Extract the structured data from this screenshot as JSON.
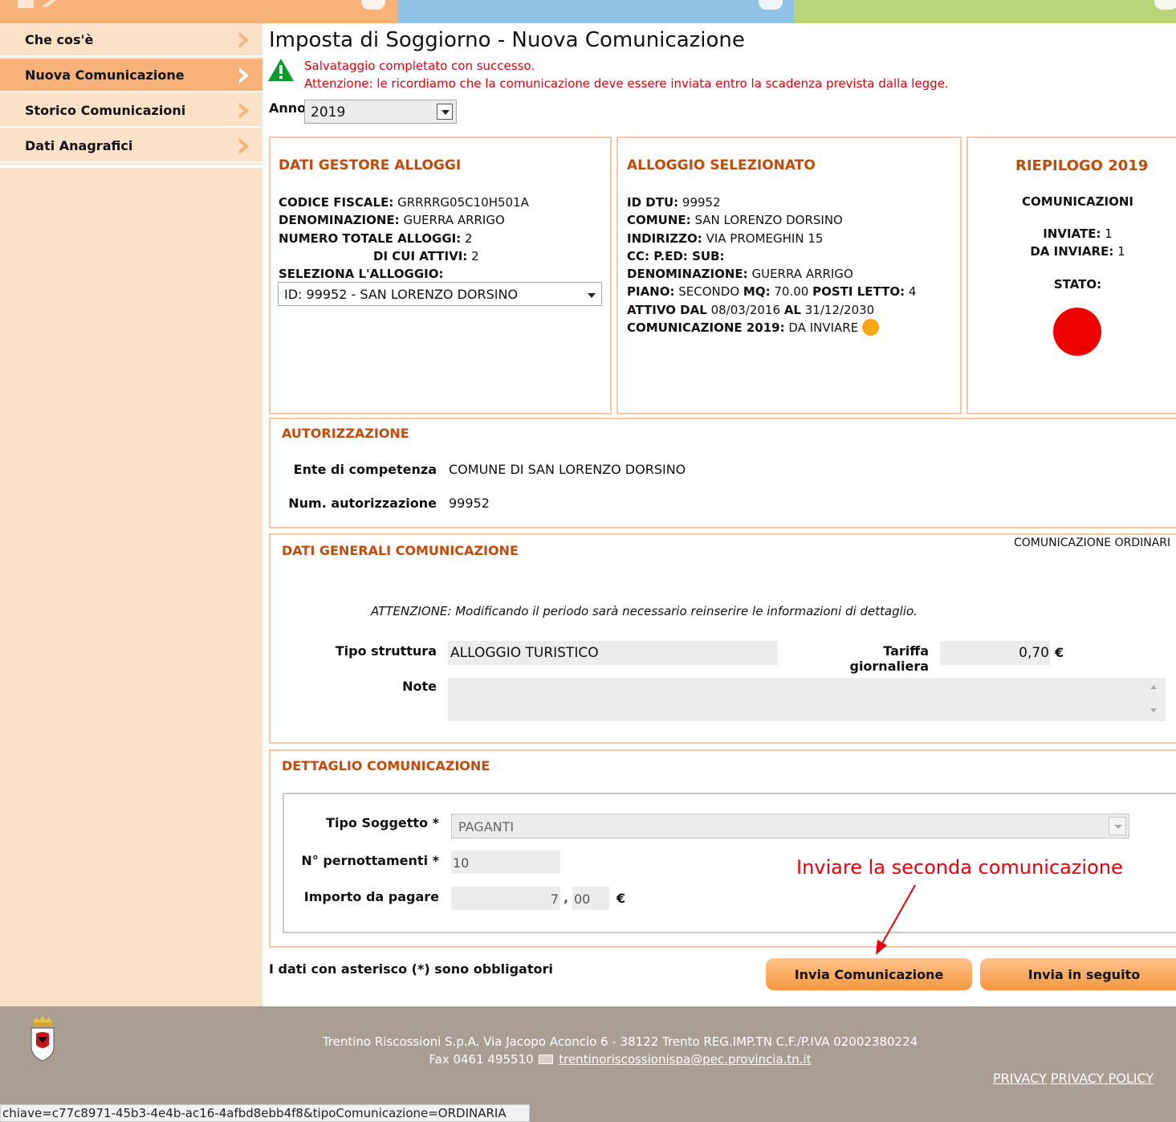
{
  "colors": {
    "accent": "#c04b0a",
    "sidebar_bg": "#fde1c8",
    "sidebar_active": "#f7b27a",
    "footer_bg": "#a89f92",
    "error_red": "#e0000d",
    "status_dot": "#ee0000",
    "pending_dot": "#f8a614"
  },
  "sidebar": {
    "items": [
      {
        "label": "Che cos'è"
      },
      {
        "label": "Nuova Comunicazione"
      },
      {
        "label": "Storico Comunicazioni"
      },
      {
        "label": "Dati Anagrafici"
      }
    ]
  },
  "page": {
    "title": "Imposta di Soggiorno - Nuova Comunicazione",
    "success_msg": "Salvataggio completato con successo.",
    "warning_msg": "Attenzione: le ricordiamo che la comunicazione deve essere inviata entro la scadenza prevista dalla legge.",
    "anno_label": "Anno",
    "anno_value": "2019"
  },
  "gestore": {
    "title": "DATI GESTORE ALLOGGI",
    "cf_label": "CODICE FISCALE:",
    "cf_value": "GRRRRG05C10H501A",
    "den_label": "DENOMINAZIONE:",
    "den_value": "GUERRA ARRIGO",
    "tot_label": "NUMERO TOTALE ALLOGGI:",
    "tot_value": "2",
    "att_label": "DI CUI ATTIVI:",
    "att_value": "2",
    "sel_label": "SELEZIONA L'ALLOGGIO:",
    "sel_value": "ID: 99952 - SAN LORENZO DORSINO"
  },
  "alloggio": {
    "title": "ALLOGGIO SELEZIONATO",
    "id_label": "ID DTU:",
    "id_value": "99952",
    "comune_label": "COMUNE:",
    "comune_value": "SAN LORENZO DORSINO",
    "ind_label": "INDIRIZZO:",
    "ind_value": "VIA PROMEGHIN 15",
    "cc_label": "CC: P.ED: SUB:",
    "den_label": "DENOMINAZIONE:",
    "den_value": "GUERRA ARRIGO",
    "piano_label": "PIANO:",
    "piano_value": "SECONDO",
    "mq_label": "MQ:",
    "mq_value": "70.00",
    "posti_label": "POSTI LETTO:",
    "posti_value": "4",
    "attivo_label": "ATTIVO DAL",
    "attivo_dal": "08/03/2016",
    "al_label": "AL",
    "attivo_al": "31/12/2030",
    "com_label": "COMUNICAZIONE 2019:",
    "com_value": "DA INVIARE"
  },
  "riepilogo": {
    "title": "RIEPILOGO 2019",
    "com_label": "COMUNICAZIONI",
    "inviate_label": "INVIATE:",
    "inviate_value": "1",
    "dainviare_label": "DA INVIARE:",
    "dainviare_value": "1",
    "stato_label": "STATO:"
  },
  "autorizzazione": {
    "title": "AUTORIZZAZIONE",
    "ente_label": "Ente di competenza",
    "ente_value": "COMUNE DI SAN LORENZO DORSINO",
    "num_label": "Num. autorizzazione",
    "num_value": "99952"
  },
  "generali": {
    "title": "DATI GENERALI COMUNICAZIONE",
    "tipo_com": "COMUNICAZIONE ORDINARI",
    "attenzione_prefix": "ATTENZIONE",
    "attenzione_text": ": Modificando il periodo sarà necessario reinserire le informazioni di dettaglio.",
    "tipo_label": "Tipo struttura",
    "tipo_value": "ALLOGGIO TURISTICO",
    "tariffa_label": "Tariffa giornaliera",
    "tariffa_value": "0,70",
    "currency": "€",
    "note_label": "Note",
    "note_value": ""
  },
  "dettaglio": {
    "title": "DETTAGLIO COMUNICAZIONE",
    "sogg_label": "Tipo Soggetto *",
    "sogg_value": "PAGANTI",
    "pern_label": "N° pernottamenti *",
    "pern_value": "10",
    "imp_label": "Importo da pagare",
    "imp_int": "7",
    "imp_sep": ",",
    "imp_dec": "00",
    "currency": "€"
  },
  "annotation": {
    "text": "Inviare la seconda comunicazione"
  },
  "actions": {
    "required_note": "I dati con asterisco (*) sono obbligatori",
    "send_label": "Invia Comunicazione",
    "later_label": "Invia in seguito"
  },
  "footer": {
    "line1": "Trentino Riscossioni S.p.A. Via Jacopo Aconcio 6 - 38122 Trento REG.IMP.TN C.F./P.IVA 02002380224",
    "fax": "Fax 0461 495510",
    "email": "trentinoriscossionispa@pec.provincia.tn.it",
    "privacy": "PRIVACY",
    "privacy_policy": "PRIVACY POLICY"
  },
  "statusbar": {
    "text": "chiave=c77c8971-45b3-4e4b-ac16-4afbd8ebb4f8&tipoComunicazione=ORDINARIA"
  }
}
